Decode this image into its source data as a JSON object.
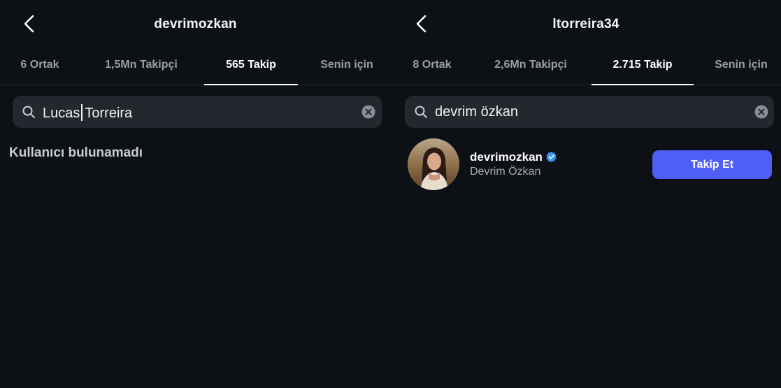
{
  "left": {
    "header": {
      "title": "devrimozkan"
    },
    "tabs": [
      {
        "label": "6 Ortak"
      },
      {
        "label": "1,5Mn Takipçi"
      },
      {
        "label": "565 Takip",
        "active": true
      },
      {
        "label": "Senin için"
      }
    ],
    "search": {
      "value_before_cursor": "Lucas",
      "value_after_cursor": "Torreira"
    },
    "empty_message": "Kullanıcı bulunamadı"
  },
  "right": {
    "header": {
      "title": "ltorreira34"
    },
    "tabs": [
      {
        "label": "8 Ortak"
      },
      {
        "label": "2,6Mn Takipçi"
      },
      {
        "label": "2.715 Takip",
        "active": true
      },
      {
        "label": "Senin için"
      }
    ],
    "search": {
      "value": "devrim özkan"
    },
    "result": {
      "username": "devrimozkan",
      "full_name": "Devrim Özkan",
      "verified": true,
      "button_label": "Takip Et"
    }
  },
  "colors": {
    "background": "#0d1015",
    "search_bg": "#23272e",
    "button_accent": "#4e5ef7",
    "verified_badge": "#3897f0"
  },
  "icons": [
    "chevron-left-icon",
    "search-icon",
    "clear-icon",
    "verified-badge-icon"
  ]
}
